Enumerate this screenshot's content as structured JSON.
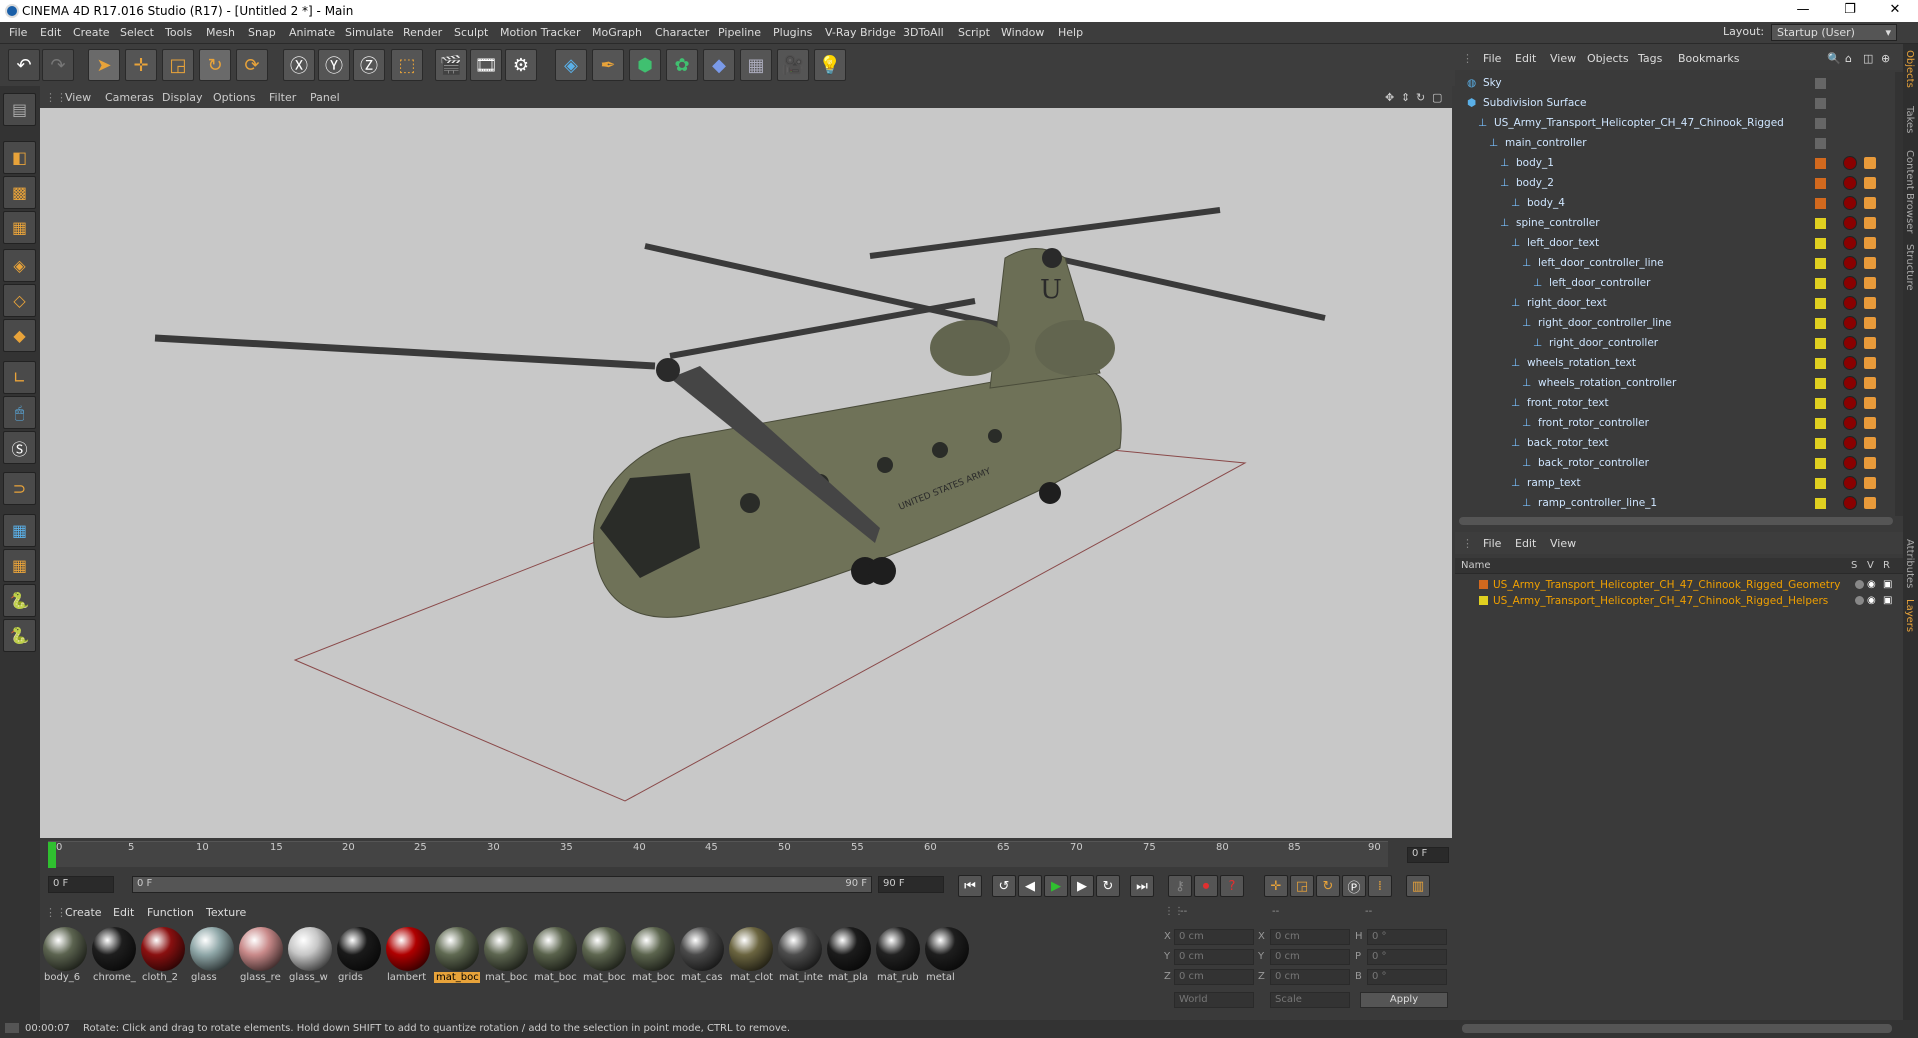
{
  "window": {
    "title": "CINEMA 4D R17.016 Studio (R17) - [Untitled 2 *] - Main",
    "minimize": "—",
    "restore": "❐",
    "close": "✕"
  },
  "menu": [
    "File",
    "Edit",
    "Create",
    "Select",
    "Tools",
    "Mesh",
    "Snap",
    "Animate",
    "Simulate",
    "Render",
    "Sculpt",
    "Motion Tracker",
    "MoGraph",
    "Character",
    "Pipeline",
    "Plugins",
    "V-Ray Bridge",
    "3DToAll",
    "Script",
    "Window",
    "Help"
  ],
  "layout": {
    "label": "Layout:",
    "value": "Startup (User)"
  },
  "viewport_menu": [
    "View",
    "Cameras",
    "Display",
    "Options",
    "Filter",
    "Panel"
  ],
  "timeline": {
    "ticks": [
      "0",
      "5",
      "10",
      "15",
      "20",
      "25",
      "30",
      "35",
      "40",
      "45",
      "50",
      "55",
      "60",
      "65",
      "70",
      "75",
      "80",
      "85",
      "90"
    ],
    "current_frame": "0 F",
    "start": "0 F",
    "range_start": "0 F",
    "range_end": "90 F",
    "end": "90 F"
  },
  "material_menu": [
    "Create",
    "Edit",
    "Function",
    "Texture"
  ],
  "materials": [
    {
      "name": "body_6",
      "color": "#5c6450"
    },
    {
      "name": "chrome_",
      "color": "#1e1e1e"
    },
    {
      "name": "cloth_2",
      "color": "#8a1010"
    },
    {
      "name": "glass",
      "color": "#8fa7a8"
    },
    {
      "name": "glass_re",
      "color": "#c98a8a"
    },
    {
      "name": "glass_w",
      "color": "#c7c7c7"
    },
    {
      "name": "grids",
      "color": "#1a1a1a"
    },
    {
      "name": "lambert",
      "color": "#b00000"
    },
    {
      "name": "mat_boc",
      "color": "#606a52"
    },
    {
      "name": "mat_boc",
      "color": "#5d6650"
    },
    {
      "name": "mat_boc",
      "color": "#5a634c"
    },
    {
      "name": "mat_boc",
      "color": "#5e6750"
    },
    {
      "name": "mat_boc",
      "color": "#5c654e"
    },
    {
      "name": "mat_cas",
      "color": "#4a4a4a"
    },
    {
      "name": "mat_clot",
      "color": "#6b6540"
    },
    {
      "name": "mat_inte",
      "color": "#4d4d4d"
    },
    {
      "name": "mat_pla",
      "color": "#1c1c1c"
    },
    {
      "name": "mat_rub",
      "color": "#222222"
    },
    {
      "name": "metal",
      "color": "#1e1e1e"
    }
  ],
  "coords": {
    "header": [
      "--",
      "--",
      "--"
    ],
    "rows": [
      {
        "a": "X",
        "av": "0 cm",
        "b": "X",
        "bv": "0 cm",
        "c": "H",
        "cv": "0 °"
      },
      {
        "a": "Y",
        "av": "0 cm",
        "b": "Y",
        "bv": "0 cm",
        "c": "P",
        "cv": "0 °"
      },
      {
        "a": "Z",
        "av": "0 cm",
        "b": "Z",
        "bv": "0 cm",
        "c": "B",
        "cv": "0 °"
      }
    ],
    "world": "World",
    "scale": "Scale",
    "apply": "Apply"
  },
  "status": {
    "time": "00:00:07",
    "message": "Rotate: Click and drag to rotate elements. Hold down SHIFT to add to quantize rotation / add to the selection in point mode, CTRL to remove."
  },
  "object_menu": [
    "File",
    "Edit",
    "View",
    "Objects",
    "Tags",
    "Bookmarks"
  ],
  "objects": [
    {
      "name": "Sky",
      "indent": 0,
      "tag": "none"
    },
    {
      "name": "Subdivision Surface",
      "indent": 0,
      "tag": "none"
    },
    {
      "name": "US_Army_Transport_Helicopter_CH_47_Chinook_Rigged",
      "indent": 1,
      "tag": "none"
    },
    {
      "name": "main_controller",
      "indent": 2,
      "tag": "none"
    },
    {
      "name": "body_1",
      "indent": 3,
      "tag": "#d2691e"
    },
    {
      "name": "body_2",
      "indent": 3,
      "tag": "#d2691e"
    },
    {
      "name": "body_4",
      "indent": 4,
      "tag": "#d2691e"
    },
    {
      "name": "spine_controller",
      "indent": 3,
      "tag": "#e0d020"
    },
    {
      "name": "left_door_text",
      "indent": 4,
      "tag": "#e0d020"
    },
    {
      "name": "left_door_controller_line",
      "indent": 5,
      "tag": "#e0d020"
    },
    {
      "name": "left_door_controller",
      "indent": 6,
      "tag": "#e0d020"
    },
    {
      "name": "right_door_text",
      "indent": 4,
      "tag": "#e0d020"
    },
    {
      "name": "right_door_controller_line",
      "indent": 5,
      "tag": "#e0d020"
    },
    {
      "name": "right_door_controller",
      "indent": 6,
      "tag": "#e0d020"
    },
    {
      "name": "wheels_rotation_text",
      "indent": 4,
      "tag": "#e0d020"
    },
    {
      "name": "wheels_rotation_controller",
      "indent": 5,
      "tag": "#e0d020"
    },
    {
      "name": "front_rotor_text",
      "indent": 4,
      "tag": "#e0d020"
    },
    {
      "name": "front_rotor_controller",
      "indent": 5,
      "tag": "#e0d020"
    },
    {
      "name": "back_rotor_text",
      "indent": 4,
      "tag": "#e0d020"
    },
    {
      "name": "back_rotor_controller",
      "indent": 5,
      "tag": "#e0d020"
    },
    {
      "name": "ramp_text",
      "indent": 4,
      "tag": "#e0d020"
    },
    {
      "name": "ramp_controller_line_1",
      "indent": 5,
      "tag": "#e0d020"
    }
  ],
  "layer_menu": [
    "File",
    "Edit",
    "View"
  ],
  "layers": {
    "header": {
      "name": "Name",
      "s": "S",
      "v": "V",
      "r": "R"
    },
    "items": [
      {
        "name": "US_Army_Transport_Helicopter_CH_47_Chinook_Rigged_Geometry",
        "color": "#d2691e"
      },
      {
        "name": "US_Army_Transport_Helicopter_CH_47_Chinook_Rigged_Helpers",
        "color": "#e0d020"
      }
    ]
  },
  "side_tabs": [
    "Objects",
    "Takes",
    "Content Browser",
    "Structure",
    "Attributes",
    "Layers"
  ],
  "icons": {
    "undo": "undo-icon",
    "move": "move-icon",
    "play": "play-icon"
  }
}
